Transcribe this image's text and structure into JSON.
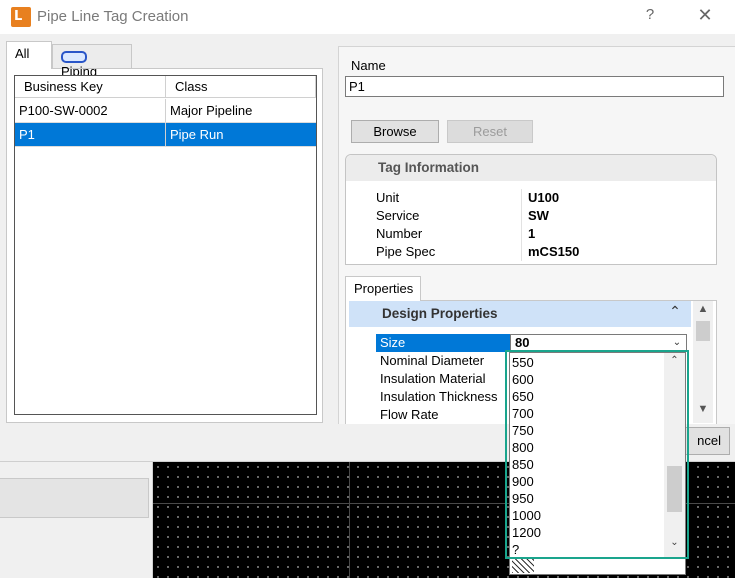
{
  "window": {
    "title": "Pipe Line Tag Creation",
    "help": "?",
    "close": "✕",
    "app_icon": "L"
  },
  "tabs": [
    {
      "label": "All"
    },
    {
      "label": "Piping"
    }
  ],
  "grid": {
    "headers": [
      "Business Key",
      "Class"
    ],
    "rows": [
      {
        "key": "P100-SW-0002",
        "class": "Major Pipeline"
      },
      {
        "key": "P1",
        "class": "Pipe Run"
      }
    ]
  },
  "name": {
    "label": "Name",
    "value": "P1"
  },
  "buttons": {
    "browse": "Browse",
    "reset": "Reset",
    "cancel": "ncel"
  },
  "tag_info": {
    "title": "Tag Information",
    "rows": [
      {
        "key": "Unit",
        "value": "U100"
      },
      {
        "key": "Service",
        "value": "SW"
      },
      {
        "key": "Number",
        "value": "1"
      },
      {
        "key": "Pipe Spec",
        "value": "mCS150"
      }
    ]
  },
  "properties": {
    "tab": "Properties",
    "section": "Design Properties",
    "rows": [
      "Size",
      "Nominal Diameter",
      "Insulation Material",
      "Insulation Thickness",
      "Flow Rate"
    ],
    "size_value": "80"
  },
  "dropdown": {
    "options": [
      "550",
      "600",
      "650",
      "700",
      "750",
      "800",
      "850",
      "900",
      "950",
      "1000",
      "1200",
      "?"
    ]
  },
  "icons": {
    "collapse": "chevron-up-icon",
    "drop": "chevron-down-icon"
  },
  "colors": {
    "selection": "#0078d7",
    "highlight": "#1aa58d",
    "section_header": "#cfe2f8",
    "app_icon": "#e8801f"
  }
}
